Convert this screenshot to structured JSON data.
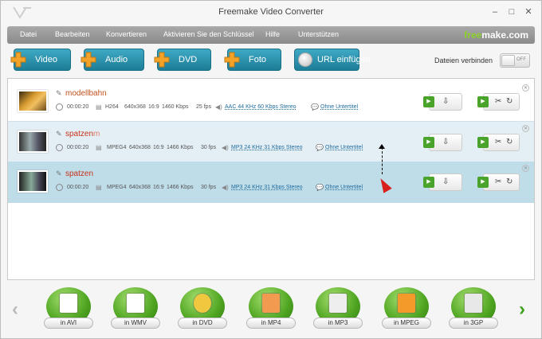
{
  "window": {
    "title": "Freemake Video Converter"
  },
  "menu": [
    "Datei",
    "Bearbeiten",
    "Konvertieren",
    "Aktivieren Sie den Schlüssel",
    "Hilfe",
    "Unterstützen"
  ],
  "brand": {
    "prefix": "free",
    "suffix": "make.com",
    "accent": "#8cd12a"
  },
  "add_buttons": [
    "Video",
    "Audio",
    "DVD",
    "Foto"
  ],
  "url_button": "URL einfügen",
  "join": {
    "label": "Dateien verbinden",
    "state": "OFF"
  },
  "files": [
    {
      "name": "modellbahn",
      "duration": "00:00:20",
      "codec": "H264",
      "resolution": "640x368",
      "aspect": "16:9",
      "bitrate": "1460 Kbps",
      "fps": "25 fps",
      "audio": "AAC  44 KHz  60 Kbps  Stereo",
      "subs": "Ohne Untertitel"
    },
    {
      "name": "spatzen",
      "ghost": "m",
      "duration": "00:00:20",
      "codec": "MPEG4",
      "resolution": "640x368",
      "aspect": "16:9",
      "bitrate": "1466 Kbps",
      "fps": "30 fps",
      "audio": "MP3  24 KHz  31 Kbps  Stereo",
      "subs": "Ohne Untertitel"
    },
    {
      "name": "spatzen",
      "duration": "00:00:20",
      "codec": "MPEG4",
      "resolution": "640x368",
      "aspect": "16:9",
      "bitrate": "1466 Kbps",
      "fps": "30 fps",
      "audio": "MP3  24 KHz  31 Kbps  Stereo",
      "subs": "Ohne Untertitel"
    }
  ],
  "outputs": [
    "in AVI",
    "in WMV",
    "in DVD",
    "in MP4",
    "in MP3",
    "in MPEG",
    "in 3GP"
  ]
}
